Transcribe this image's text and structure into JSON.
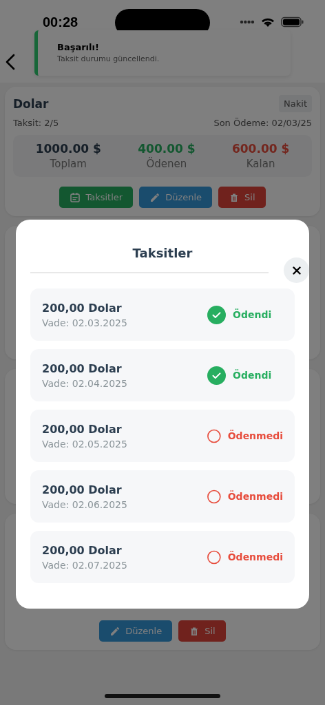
{
  "status_bar": {
    "time": "00:28"
  },
  "toast": {
    "title": "Başarılı!",
    "message": "Taksit durumu güncellendi."
  },
  "card": {
    "title": "Dolar",
    "badge": "Nakit",
    "installment_text": "Taksit: 2/5",
    "last_payment": "Son Ödeme: 02/03/25",
    "stats": [
      {
        "value": "1000.00 $",
        "label": "Toplam",
        "kind": "total"
      },
      {
        "value": "400.00 $",
        "label": "Ödenen",
        "kind": "paid"
      },
      {
        "value": "600.00 $",
        "label": "Kalan",
        "kind": "remaining"
      }
    ],
    "buttons": [
      {
        "label": "Taksitler",
        "kind": "installments"
      },
      {
        "label": "Düzenle",
        "kind": "edit"
      },
      {
        "label": "Sil",
        "kind": "delete"
      }
    ]
  },
  "last_card": {
    "buttons": [
      {
        "label": "Düzenle",
        "kind": "edit"
      },
      {
        "label": "Sil",
        "kind": "delete"
      }
    ]
  },
  "modal": {
    "title": "Taksitler",
    "installments": [
      {
        "amount": "200,00 Dolar",
        "due": "Vade: 02.03.2025",
        "paid": true,
        "status": "Ödendi"
      },
      {
        "amount": "200,00 Dolar",
        "due": "Vade: 02.04.2025",
        "paid": true,
        "status": "Ödendi"
      },
      {
        "amount": "200,00 Dolar",
        "due": "Vade: 02.05.2025",
        "paid": false,
        "status": "Ödenmedi"
      },
      {
        "amount": "200,00 Dolar",
        "due": "Vade: 02.06.2025",
        "paid": false,
        "status": "Ödenmedi"
      },
      {
        "amount": "200,00 Dolar",
        "due": "Vade: 02.07.2025",
        "paid": false,
        "status": "Ödenmedi"
      }
    ]
  }
}
